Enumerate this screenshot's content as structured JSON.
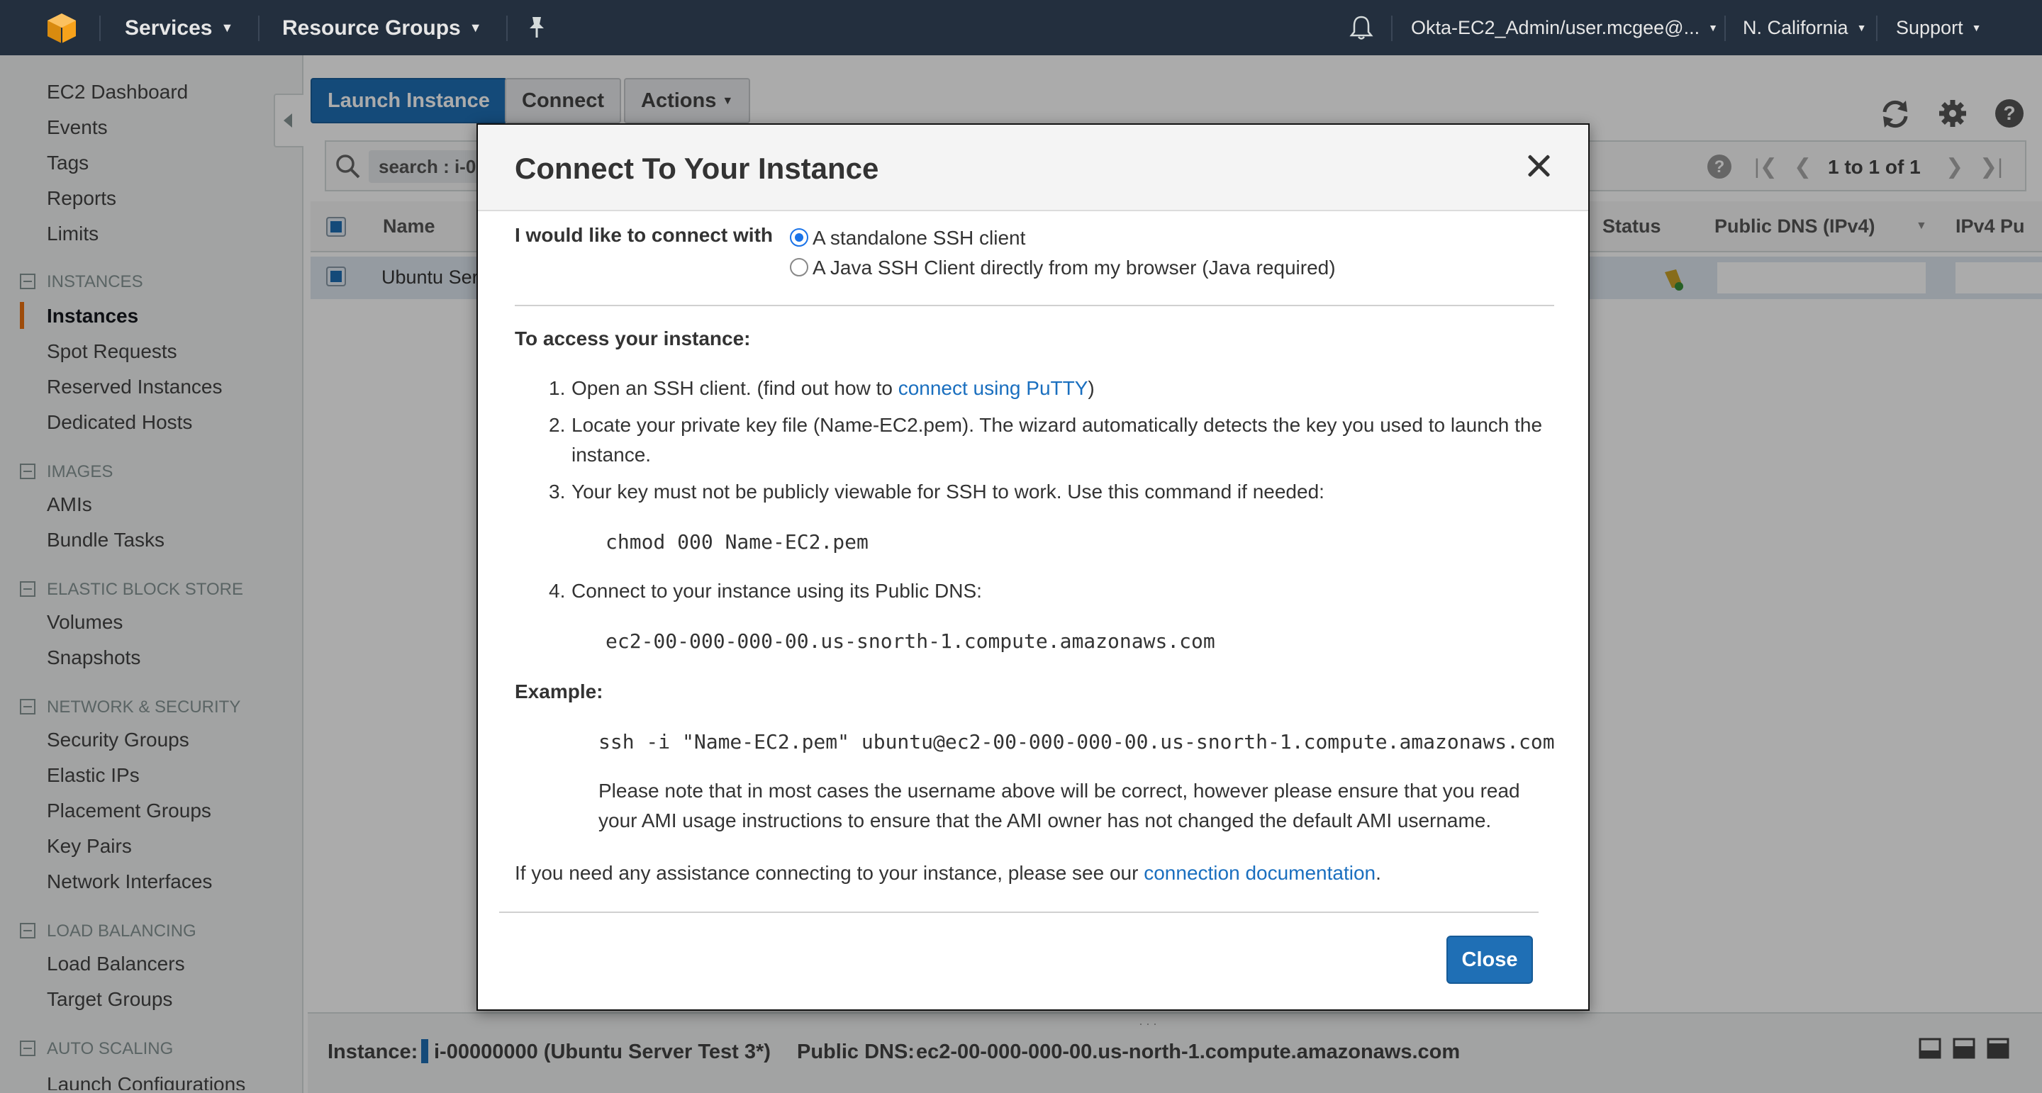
{
  "topnav": {
    "services": "Services",
    "resource_groups": "Resource Groups",
    "account": "Okta-EC2_Admin/user.mcgee@...",
    "region": "N. California",
    "support": "Support",
    "bg_color": "#232f3e"
  },
  "sidebar": {
    "items": {
      "dashboard": "EC2 Dashboard",
      "events": "Events",
      "tags": "Tags",
      "reports": "Reports",
      "limits": "Limits",
      "instances_head": "INSTANCES",
      "instances": "Instances",
      "spot": "Spot Requests",
      "reserved": "Reserved Instances",
      "dedicated": "Dedicated Hosts",
      "images_head": "IMAGES",
      "amis": "AMIs",
      "bundle": "Bundle Tasks",
      "ebs_head": "ELASTIC BLOCK STORE",
      "volumes": "Volumes",
      "snapshots": "Snapshots",
      "netsec_head": "NETWORK & SECURITY",
      "secgroups": "Security Groups",
      "eips": "Elastic IPs",
      "placement": "Placement Groups",
      "keypairs": "Key Pairs",
      "netifaces": "Network Interfaces",
      "lb_head": "LOAD BALANCING",
      "lbs": "Load Balancers",
      "targets": "Target Groups",
      "as_head": "AUTO SCALING",
      "launchcfg": "Launch Configurations"
    }
  },
  "toolbar": {
    "launch": "Launch Instance",
    "connect": "Connect",
    "actions": "Actions"
  },
  "search": {
    "chip": "search : i-0"
  },
  "pagination": "1 to 1 of 1",
  "table": {
    "col_name": "Name",
    "col_status": "Status",
    "col_public_dns": "Public DNS (IPv4)",
    "col_ipv4": "IPv4 Pu",
    "row_name": "Ubuntu Ser"
  },
  "bottom": {
    "instance_label": "Instance:",
    "instance_value": "i-00000000 (Ubuntu Server Test 3*)",
    "dns_label": "Public DNS:",
    "dns_value": "ec2-00-000-000-00.us-north-1.compute.amazonaws.com"
  },
  "modal": {
    "title": "Connect To Your Instance",
    "connect_with_label": "I would like to connect with",
    "option_ssh": "A standalone SSH client",
    "option_java": "A Java SSH Client directly from my browser (Java required)",
    "access_heading": "To access your instance:",
    "step1_num": "1.",
    "step1_text": "Open an SSH client. (find out how to",
    "step1_link": "connect using PuTTY",
    "step1_close": ")",
    "step2_num": "2.",
    "step2_line1": "Locate your private key file (Name-EC2.pem). The wizard automatically detects the key you used to launch the",
    "step2_line2": "instance.",
    "step3_num": "3.",
    "step3_text": "Your key must not be publicly viewable for SSH to work. Use this command if needed:",
    "chmod_cmd": "chmod 000 Name-EC2.pem",
    "step4_num": "4.",
    "step4_text": "Connect to your instance using its Public DNS:",
    "dns_cmd": "ec2-00-000-000-00.us-snorth-1.compute.amazonaws.com",
    "example_heading": "Example:",
    "ssh_cmd": "ssh -i \"Name-EC2.pem\" ubuntu@ec2-00-000-000-00.us-snorth-1.compute.amazonaws.com",
    "note_line1": "Please note that in most cases the username above will be correct, however please ensure that you read",
    "note_line2": "your AMI usage instructions to ensure that the AMI owner has not changed the default AMI username.",
    "assist_text": "If you need any assistance connecting to your instance, please see our",
    "assist_link": "connection documentation",
    "assist_period": ".",
    "close_button": "Close",
    "selected_option": "A standalone SSH client"
  },
  "colors": {
    "primary_blue": "#1f6fb5",
    "link_blue": "#1a6fbf",
    "active_orange": "#ec7211"
  }
}
